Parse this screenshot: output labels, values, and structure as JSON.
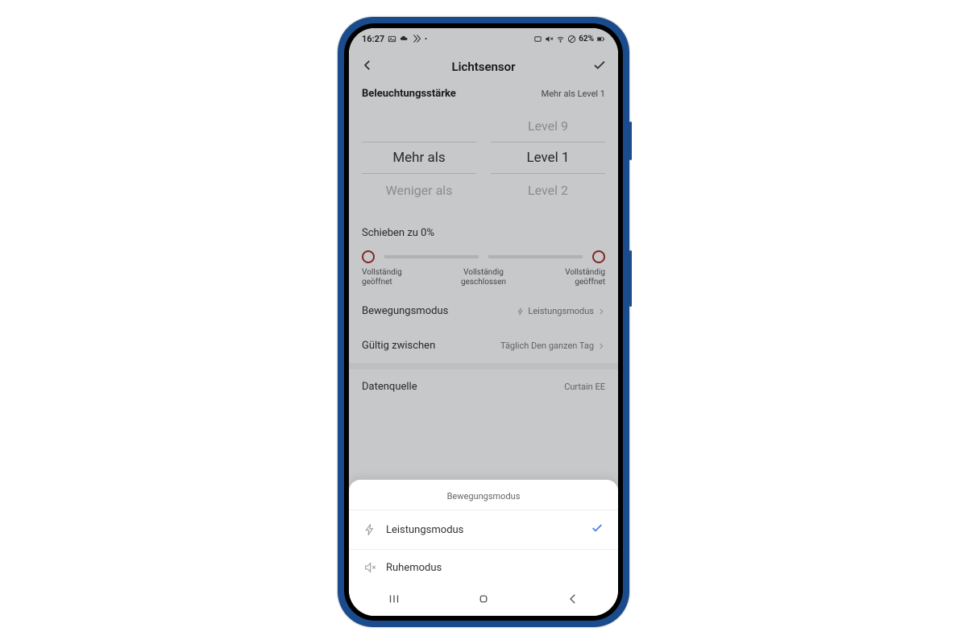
{
  "status": {
    "time": "16:27",
    "battery": "62%"
  },
  "header": {
    "title": "Lichtsensor"
  },
  "illuminance": {
    "label": "Beleuchtungsstärke",
    "value": "Mehr als Level 1"
  },
  "picker": {
    "col1": {
      "above": "",
      "selected": "Mehr als",
      "below": "Weniger als"
    },
    "col2": {
      "above": "Level 9",
      "selected": "Level 1",
      "below": "Level 2"
    }
  },
  "slide": {
    "title": "Schieben zu 0%",
    "left_label": "Vollständig geöffnet",
    "mid_label": "Vollständig geschlossen",
    "right_label": "Vollständig geöffnet"
  },
  "rows": {
    "motion": {
      "label": "Bewegungsmodus",
      "value": "Leistungsmodus"
    },
    "valid": {
      "label": "Gültig zwischen",
      "value": "Täglich Den ganzen Tag"
    },
    "source": {
      "label": "Datenquelle",
      "value": "Curtain EE"
    }
  },
  "sheet": {
    "title": "Bewegungsmodus",
    "option1": "Leistungsmodus",
    "option2": "Ruhemodus"
  }
}
